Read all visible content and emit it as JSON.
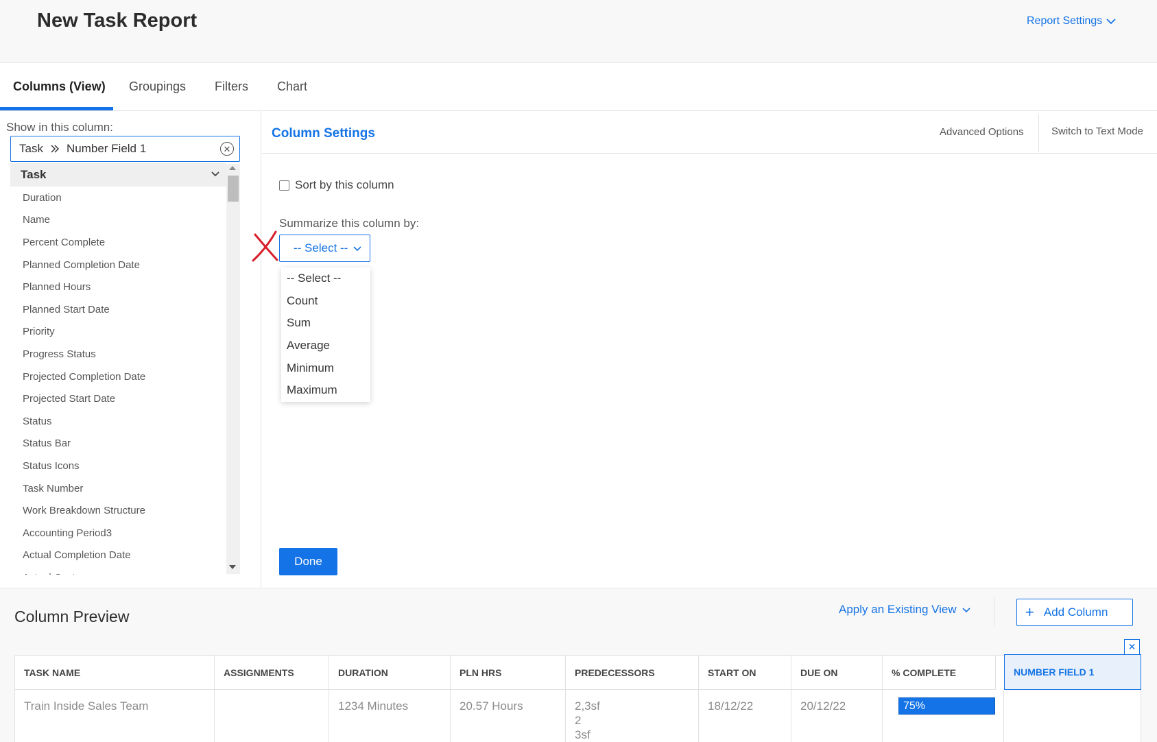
{
  "header": {
    "title": "New Task Report",
    "report_settings": "Report Settings"
  },
  "tabs": [
    {
      "label": "Columns (View)",
      "active": true
    },
    {
      "label": "Groupings"
    },
    {
      "label": "Filters"
    },
    {
      "label": "Chart"
    }
  ],
  "left_panel": {
    "show_label": "Show in this column:",
    "breadcrumb": [
      "Task",
      "Number Field 1"
    ],
    "group_label": "Task",
    "fields": [
      "Duration",
      "Name",
      "Percent Complete",
      "Planned Completion Date",
      "Planned Hours",
      "Planned Start Date",
      "Priority",
      "Progress Status",
      "Projected Completion Date",
      "Projected Start Date",
      "Status",
      "Status Bar",
      "Status Icons",
      "Task Number",
      "Work Breakdown Structure",
      "Accounting Period3",
      "Actual Completion Date",
      "Actual Cost"
    ]
  },
  "settings": {
    "title": "Column Settings",
    "advanced_options": "Advanced Options",
    "switch_text_mode": "Switch to Text Mode",
    "sort_label": "Sort by this column",
    "sort_checked": false,
    "summarize_label": "Summarize this column by:",
    "select_value": "-- Select --",
    "options": [
      "-- Select --",
      "Count",
      "Sum",
      "Average",
      "Minimum",
      "Maximum"
    ],
    "done_label": "Done"
  },
  "preview": {
    "title": "Column Preview",
    "apply_view": "Apply an Existing View",
    "add_column": "Add Column",
    "columns": [
      "TASK NAME",
      "ASSIGNMENTS",
      "DURATION",
      "PLN HRS",
      "PREDECESSORS",
      "START ON",
      "DUE ON",
      "% COMPLETE",
      "NUMBER FIELD 1"
    ],
    "row": {
      "task_name": "Train Inside Sales Team",
      "assignments": "",
      "duration": "1234 Minutes",
      "pln_hrs": "20.57 Hours",
      "predecessors": [
        "2,3sf",
        "2",
        "3sf"
      ],
      "start_on": "18/12/22",
      "due_on": "20/12/22",
      "percent_complete": "75%",
      "percent_value": 0.75,
      "number_field_1": ""
    }
  },
  "colors": {
    "accent": "#1473e6",
    "annotation_mark": "#d81e2a"
  }
}
